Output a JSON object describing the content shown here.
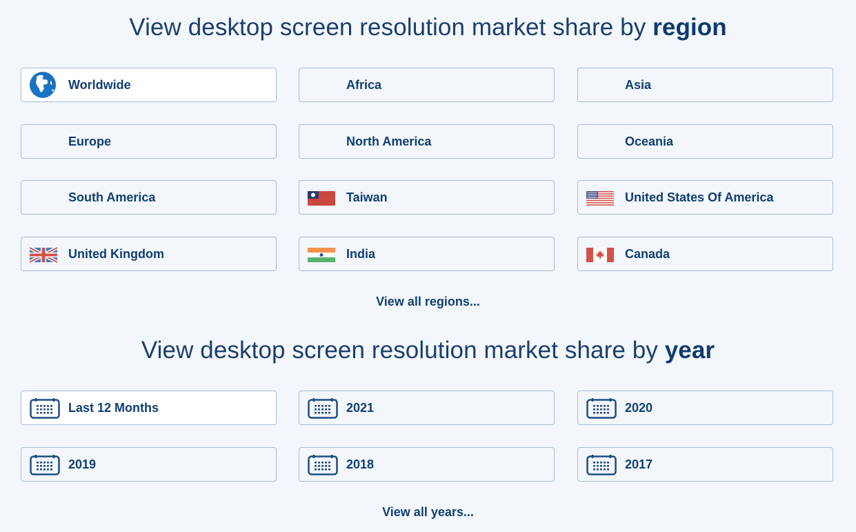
{
  "region_section": {
    "heading_prefix": "View desktop screen resolution market share by",
    "heading_emphasis": "region",
    "items": [
      {
        "label": "Worldwide",
        "icon": "globe-icon",
        "active": true
      },
      {
        "label": "Africa",
        "icon": null
      },
      {
        "label": "Asia",
        "icon": null
      },
      {
        "label": "Europe",
        "icon": null
      },
      {
        "label": "North America",
        "icon": null
      },
      {
        "label": "Oceania",
        "icon": null
      },
      {
        "label": "South America",
        "icon": null
      },
      {
        "label": "Taiwan",
        "icon": "taiwan-flag-icon"
      },
      {
        "label": "United States Of America",
        "icon": "usa-flag-icon"
      },
      {
        "label": "United Kingdom",
        "icon": "uk-flag-icon"
      },
      {
        "label": "India",
        "icon": "india-flag-icon"
      },
      {
        "label": "Canada",
        "icon": "canada-flag-icon"
      }
    ],
    "view_all": "View all regions..."
  },
  "year_section": {
    "heading_prefix": "View desktop screen resolution market share by",
    "heading_emphasis": "year",
    "items": [
      {
        "label": "Last 12 Months",
        "icon": "calendar-icon",
        "active": true
      },
      {
        "label": "2021",
        "icon": "calendar-icon"
      },
      {
        "label": "2020",
        "icon": "calendar-icon"
      },
      {
        "label": "2019",
        "icon": "calendar-icon"
      },
      {
        "label": "2018",
        "icon": "calendar-icon"
      },
      {
        "label": "2017",
        "icon": "calendar-icon"
      }
    ],
    "view_all": "View all years..."
  },
  "colors": {
    "background": "#f3f6fa",
    "text": "#103f73",
    "border": "#a9bdd6",
    "globe": "#1a73c0"
  }
}
